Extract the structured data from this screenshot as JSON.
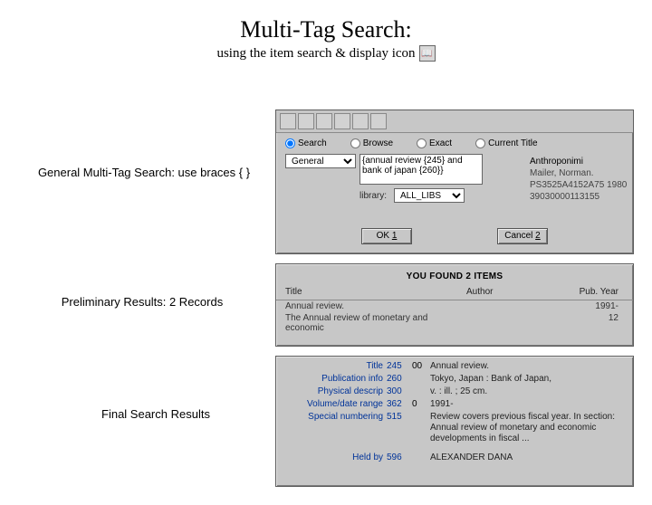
{
  "heading": {
    "title": "Multi-Tag Search:",
    "subtitle": "using the item search & display icon",
    "icon_name": "book-search-icon"
  },
  "captions": {
    "a": "General Multi-Tag Search: use braces { }",
    "b": "Preliminary Results: 2 Records",
    "c": "Final Search Results"
  },
  "modes": {
    "search": "Search",
    "browse": "Browse",
    "exact": "Exact",
    "current": "Current Title"
  },
  "selectors": {
    "type_value": "General",
    "library_label": "library:",
    "library_value": "ALL_LIBS"
  },
  "query_text": "{annual review {245} and bank of japan {260}}",
  "record_preview": {
    "l1": "Anthroponimi",
    "l2": "Mailer, Norman.",
    "l3": "PS3525A4152A75 1980",
    "l4": "39030000113155"
  },
  "buttons": {
    "ok": "OK",
    "cancel": "Cancel"
  },
  "results": {
    "found_banner": "YOU FOUND 2 ITEMS",
    "headers": {
      "title": "Title",
      "author": "Author",
      "pubyear": "Pub. Year"
    },
    "rows": [
      {
        "title": "Annual review.",
        "author": "",
        "year": "1991-"
      },
      {
        "title": "The Annual review of monetary and economic",
        "author": "",
        "year": "12"
      }
    ]
  },
  "detail": [
    {
      "label": "Title",
      "tag": "245",
      "sub": "00",
      "value": "Annual review."
    },
    {
      "label": "Publication info",
      "tag": "260",
      "sub": "",
      "value": "Tokyo, Japan : Bank of Japan,"
    },
    {
      "label": "Physical descrip",
      "tag": "300",
      "sub": "",
      "value": "v. : ill. ; 25 cm."
    },
    {
      "label": "Volume/date range",
      "tag": "362",
      "sub": "0",
      "value": "1991-"
    },
    {
      "label": "Special numbering",
      "tag": "515",
      "sub": "",
      "value": "Review covers previous fiscal year. In section: Annual review of monetary and economic developments in fiscal ..."
    },
    {
      "label": "Held by",
      "tag": "596",
      "sub": "",
      "value": "ALEXANDER DANA"
    }
  ]
}
